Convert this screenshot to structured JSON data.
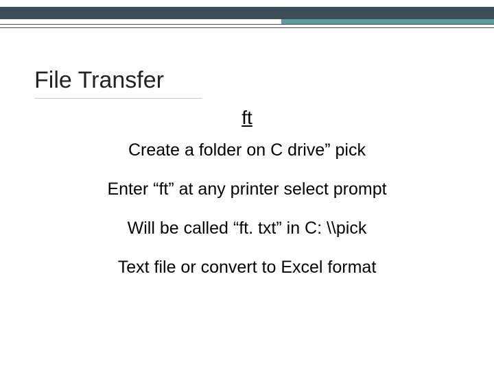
{
  "title": "File Transfer",
  "subtitle": "ft",
  "bullets": [
    "Create a folder on C drive” pick",
    "Enter “ft” at any printer select prompt",
    "Will be called “ft. txt” in  C: \\\\pick",
    "Text file or convert to Excel format"
  ]
}
